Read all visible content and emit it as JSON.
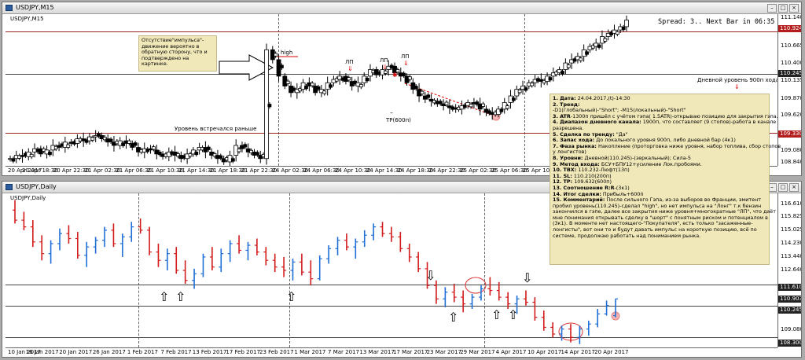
{
  "top_window": {
    "title": "USDJPY,M15",
    "symbol_label": "USDJPY,M15",
    "spread_info": "Spread: 3.. Next Bar in 06:35",
    "note_left": [
      "Отсутствие\"импульса\"-",
      "движение вероятно в",
      "обратную сторону, что и",
      "подтверждено на",
      "картинке."
    ],
    "label_high": "high",
    "label_lp": "ЛП",
    "label_tp": "TP(600п)",
    "label_level": "Уровень встречался раньше",
    "label_day_level": "Дневной уровень 900п хода",
    "price_badges": [
      "110.924",
      "110.245",
      "109.330"
    ]
  },
  "bottom_window": {
    "title": "USDJPY,Daily",
    "symbol_label": "USDJPY,Daily",
    "price_badges": [
      "111.610",
      "110.903",
      "110.245",
      "108.300"
    ]
  },
  "trade_note": [
    {
      "b": "1. Дата:",
      "t": " 24.04.2017,(t)-14:30"
    },
    {
      "b": "2. Тренд:",
      "t": ""
    },
    {
      "b": "",
      "t": "-D1(глобальный)-\"Short\"; -M15(локальный)-\"Short\""
    },
    {
      "b": "3. ATR",
      "t": "-1300п пришёл с учётом гэпа( 1.5ATR)-открываю позицию для закрытия гэпа."
    },
    {
      "b": "4. Диапазон дневного канала:",
      "t": " 1900п, что составляет (9 стопов)-работа в канале"
    },
    {
      "b": "",
      "t": "разрешена."
    },
    {
      "b": "5. Сделка по тренду:",
      "t": " \"Да\""
    },
    {
      "b": "6. Запас хода:",
      "t": " До локального уровня 900п, либо дневной бар (4к1)"
    },
    {
      "b": "7. Фаза рынка:",
      "t": " Накопление (проторговка ниже уровня, набор топлива, сбор стопов"
    },
    {
      "b": "",
      "t": "у лонгистов)"
    },
    {
      "b": "8. Уровни:",
      "t": " Дневной(110.245)-(зеркальный); Сила-5"
    },
    {
      "b": "9. Метод входа:",
      "t": " БСУ+БПУ12+усиление Лок.пробоями."
    },
    {
      "b": "10. ТВХ:",
      "t": " 110.232-Люфт(13п)"
    },
    {
      "b": "11. SL:",
      "t": " 110.210(200п)"
    },
    {
      "b": "12. TP:",
      "t": " 109.632(600п)"
    },
    {
      "b": "13. Соотношение R:R",
      "t": "-(3к1)"
    },
    {
      "b": "14. Итог сделки:",
      "t": " Прибыль+600п"
    },
    {
      "b": "15. Комментарий:",
      "t": " После сильного Гэпа, из-за выборов во Франции, эмитент"
    },
    {
      "b": "",
      "t": "пробил уровень(110.245)-сделал \"high\", но нет импульса на \"Лонг\" т.к бензин"
    },
    {
      "b": "",
      "t": "закончился в гэпе, далее все закрытия ниже уровня+многократные \"ЛП\", что даёт"
    },
    {
      "b": "",
      "t": "мне понимания открывать сделку в \"шорт\" с понятным риском и потенциалом в"
    },
    {
      "b": "",
      "t": "(3к1). В моменте нет настоящего-\"Покупателя\", есть только \"засаженные-"
    },
    {
      "b": "",
      "t": "лонгисты\", вот они то и будут давать импульс на короткую позицию, всё по"
    },
    {
      "b": "",
      "t": "системе, продолжаю работать над пониманием рынка."
    }
  ],
  "chart_data": [
    {
      "type": "candlestick",
      "title": "USDJPY,M15",
      "y_ticks": [
        "111.140",
        "110.924",
        "110.665",
        "110.400",
        "110.245",
        "110.135",
        "109.870",
        "109.620",
        "109.330",
        "109.080",
        "108.840"
      ],
      "x_ticks": [
        "20 Apr 2017",
        "20 Apr 18:30",
        "20 Apr 22:30",
        "21 Apr 02:30",
        "21 Apr 06:30",
        "21 Apr 10:30",
        "21 Apr 14:30",
        "21 Apr 18:30",
        "21 Apr 22:30",
        "24 Apr 02:30",
        "24 Apr 06:30",
        "24 Apr 10:30",
        "24 Apr 14:30",
        "24 Apr 18:30",
        "24 Apr 22:30",
        "25 Apr 02:30",
        "25 Apr 06:30",
        "25 Apr 10:30"
      ],
      "ylim": [
        108.84,
        111.14
      ],
      "levels": [
        110.924,
        110.245,
        109.33
      ],
      "close_path": [
        108.95,
        109.0,
        108.98,
        109.05,
        109.1,
        109.02,
        109.08,
        109.15,
        109.12,
        109.2,
        109.18,
        109.25,
        109.22,
        109.28,
        109.3,
        109.25,
        109.2,
        109.15,
        109.22,
        109.18,
        109.12,
        109.05,
        109.1,
        109.08,
        109.02,
        108.98,
        109.05,
        109.0,
        108.95,
        109.02,
        109.08,
        109.12,
        109.05,
        109.0,
        108.95,
        108.9,
        109.0,
        109.15,
        109.1,
        109.05,
        109.0,
        108.95,
        110.6,
        110.45,
        110.2,
        110.05,
        109.95,
        110.0,
        110.1,
        110.05,
        109.95,
        110.0,
        110.1,
        110.15,
        110.2,
        110.12,
        110.05,
        110.1,
        110.2,
        110.3,
        110.22,
        110.3,
        110.35,
        110.25,
        110.2,
        110.1,
        110.0,
        109.9,
        109.85,
        109.82,
        109.78,
        109.75,
        109.72,
        109.7,
        109.75,
        109.8,
        109.78,
        109.7,
        109.65,
        109.62,
        109.7,
        109.8,
        109.9,
        110.0,
        110.05,
        110.1,
        110.15,
        110.12,
        110.2,
        110.25,
        110.3,
        110.4,
        110.45,
        110.5,
        110.6,
        110.65,
        110.7,
        110.8,
        110.85,
        110.9,
        110.95,
        111.05
      ]
    },
    {
      "type": "candlestick",
      "title": "USDJPY,Daily",
      "y_ticks": [
        "116.610",
        "115.825",
        "115.025",
        "114.230",
        "113.440",
        "112.640",
        "111.610",
        "110.903",
        "110.245",
        "109.080",
        "108.300"
      ],
      "x_ticks": [
        "10 Jan 2017",
        "16 Jan 2017",
        "20 Jan 2017",
        "26 Jan 2017",
        "1 Feb 2017",
        "7 Feb 2017",
        "13 Feb 2017",
        "17 Feb 2017",
        "23 Feb 2017",
        "1 Mar 2017",
        "7 Mar 2017",
        "13 Mar 2017",
        "17 Mar 2017",
        "23 Mar 2017",
        "29 Mar 2017",
        "4 Apr 2017",
        "10 Apr 2017",
        "14 Apr 2017",
        "20 Apr 2017"
      ],
      "ylim": [
        108.0,
        117.2
      ],
      "levels": [
        111.61,
        110.245,
        108.3
      ],
      "ohlc": [
        [
          116.2,
          116.8,
          115.4,
          115.6
        ],
        [
          115.6,
          116.1,
          115.0,
          115.2
        ],
        [
          115.2,
          115.6,
          114.0,
          114.3
        ],
        [
          114.3,
          114.7,
          113.2,
          113.6
        ],
        [
          113.6,
          114.4,
          113.0,
          114.2
        ],
        [
          114.2,
          115.1,
          113.8,
          114.8
        ],
        [
          114.8,
          115.3,
          114.2,
          114.5
        ],
        [
          114.5,
          114.9,
          113.3,
          113.5
        ],
        [
          113.5,
          114.3,
          112.8,
          114.0
        ],
        [
          114.0,
          114.6,
          113.6,
          114.4
        ],
        [
          114.4,
          115.2,
          114.0,
          115.0
        ],
        [
          115.0,
          115.4,
          114.0,
          114.2
        ],
        [
          114.2,
          114.8,
          113.4,
          114.6
        ],
        [
          114.6,
          115.5,
          114.3,
          115.2
        ],
        [
          115.2,
          115.7,
          114.8,
          115.0
        ],
        [
          115.0,
          115.2,
          113.5,
          113.7
        ],
        [
          113.7,
          114.2,
          112.8,
          113.2
        ],
        [
          113.2,
          113.9,
          112.6,
          113.6
        ],
        [
          113.6,
          114.0,
          112.4,
          112.6
        ],
        [
          112.6,
          113.2,
          111.8,
          112.0
        ],
        [
          112.0,
          112.7,
          111.5,
          112.4
        ],
        [
          112.4,
          113.6,
          112.2,
          113.4
        ],
        [
          113.4,
          114.0,
          112.6,
          112.8
        ],
        [
          112.8,
          113.9,
          112.5,
          113.6
        ],
        [
          113.6,
          114.4,
          113.1,
          114.2
        ],
        [
          114.2,
          114.7,
          113.6,
          113.8
        ],
        [
          113.8,
          114.3,
          113.2,
          114.1
        ],
        [
          114.1,
          114.5,
          113.5,
          113.7
        ],
        [
          113.7,
          114.0,
          112.9,
          113.2
        ],
        [
          113.2,
          113.6,
          112.5,
          112.8
        ],
        [
          112.8,
          113.4,
          112.2,
          112.6
        ],
        [
          112.6,
          113.3,
          112.0,
          113.1
        ],
        [
          113.1,
          113.6,
          112.3,
          112.5
        ],
        [
          112.5,
          113.2,
          111.7,
          112.1
        ],
        [
          112.1,
          113.5,
          112.0,
          113.3
        ],
        [
          113.3,
          114.1,
          113.0,
          113.9
        ],
        [
          113.9,
          114.6,
          113.5,
          114.4
        ],
        [
          114.4,
          114.8,
          113.8,
          114.0
        ],
        [
          114.0,
          114.5,
          113.3,
          114.3
        ],
        [
          114.3,
          115.0,
          114.0,
          114.7
        ],
        [
          114.7,
          115.4,
          114.4,
          115.2
        ],
        [
          115.2,
          115.5,
          114.6,
          114.8
        ],
        [
          114.8,
          115.2,
          114.3,
          114.6
        ],
        [
          114.6,
          114.9,
          113.7,
          113.9
        ],
        [
          113.9,
          114.2,
          113.1,
          113.4
        ],
        [
          113.4,
          113.7,
          112.5,
          112.7
        ],
        [
          112.7,
          113.1,
          111.5,
          111.7
        ],
        [
          111.7,
          112.0,
          110.6,
          110.9
        ],
        [
          110.9,
          111.6,
          110.4,
          111.3
        ],
        [
          111.3,
          111.8,
          110.7,
          111.0
        ],
        [
          111.0,
          111.4,
          110.1,
          110.6
        ],
        [
          110.6,
          111.2,
          110.3,
          111.0
        ],
        [
          111.0,
          111.7,
          110.8,
          111.5
        ],
        [
          111.5,
          112.2,
          111.1,
          111.4
        ],
        [
          111.4,
          111.9,
          110.8,
          111.0
        ],
        [
          111.0,
          111.3,
          110.3,
          110.6
        ],
        [
          110.6,
          111.1,
          110.0,
          110.9
        ],
        [
          110.9,
          111.4,
          110.5,
          110.7
        ],
        [
          110.7,
          111.0,
          109.6,
          109.8
        ],
        [
          109.8,
          110.2,
          109.0,
          109.2
        ],
        [
          109.2,
          109.5,
          108.6,
          108.8
        ],
        [
          108.8,
          109.3,
          108.4,
          109.1
        ],
        [
          109.1,
          109.4,
          108.3,
          108.6
        ],
        [
          108.6,
          109.3,
          108.2,
          109.1
        ],
        [
          109.1,
          109.6,
          108.7,
          109.4
        ],
        [
          109.4,
          110.3,
          109.2,
          110.0
        ],
        [
          110.0,
          110.8,
          109.9,
          110.5
        ],
        [
          109.9,
          110.9,
          109.8,
          110.9
        ]
      ]
    }
  ]
}
